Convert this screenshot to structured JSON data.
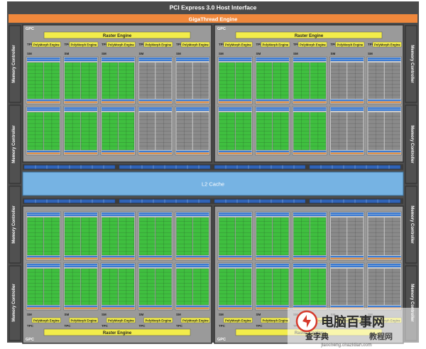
{
  "header": {
    "pcie_label": "PCI Express 3.0 Host Interface",
    "gigathread_label": "GigaThread Engine"
  },
  "memory_controller_label": "Memory Controller",
  "l2_cache_label": "L2 Cache",
  "gpc": {
    "label": "GPC",
    "raster_engine_label": "Raster Engine",
    "tpc_label": "TPC",
    "polymorph_label": "PolyMorph Engine",
    "sm_label": "SM"
  },
  "layout_counts": {
    "gpcs": 4,
    "tpcs_per_gpc": 5,
    "sms_per_tpc": 2,
    "memory_controllers_per_side": 4
  },
  "enabled_sm_pattern": [
    [
      true,
      true,
      true,
      false,
      false
    ],
    [
      true,
      true,
      true,
      false,
      false
    ],
    [
      true,
      true,
      true,
      true,
      true
    ],
    [
      true,
      true,
      true,
      false,
      false
    ]
  ],
  "colors": {
    "pcie_bar": "#4a4a4a",
    "gigathread": "#f0883c",
    "raster_engine": "#f2ec4a",
    "polymorph": "#f2ec4a",
    "l2_cache": "#76b3e3",
    "memory_controller": "#505050",
    "gpc_frame": "#5a5a5a",
    "cuda_core_enabled": "#3fbf3f",
    "cuda_core_disabled": "#8a8a8a",
    "register_bar": "#3a7bd5",
    "cache_bar": "#e08a3a",
    "background": "#4c4c4c"
  },
  "watermark": {
    "brand": "电脑百事网",
    "sub_left": "查字典",
    "sub_right": "教程网",
    "url": "jiaocheng.chazidian.com"
  }
}
